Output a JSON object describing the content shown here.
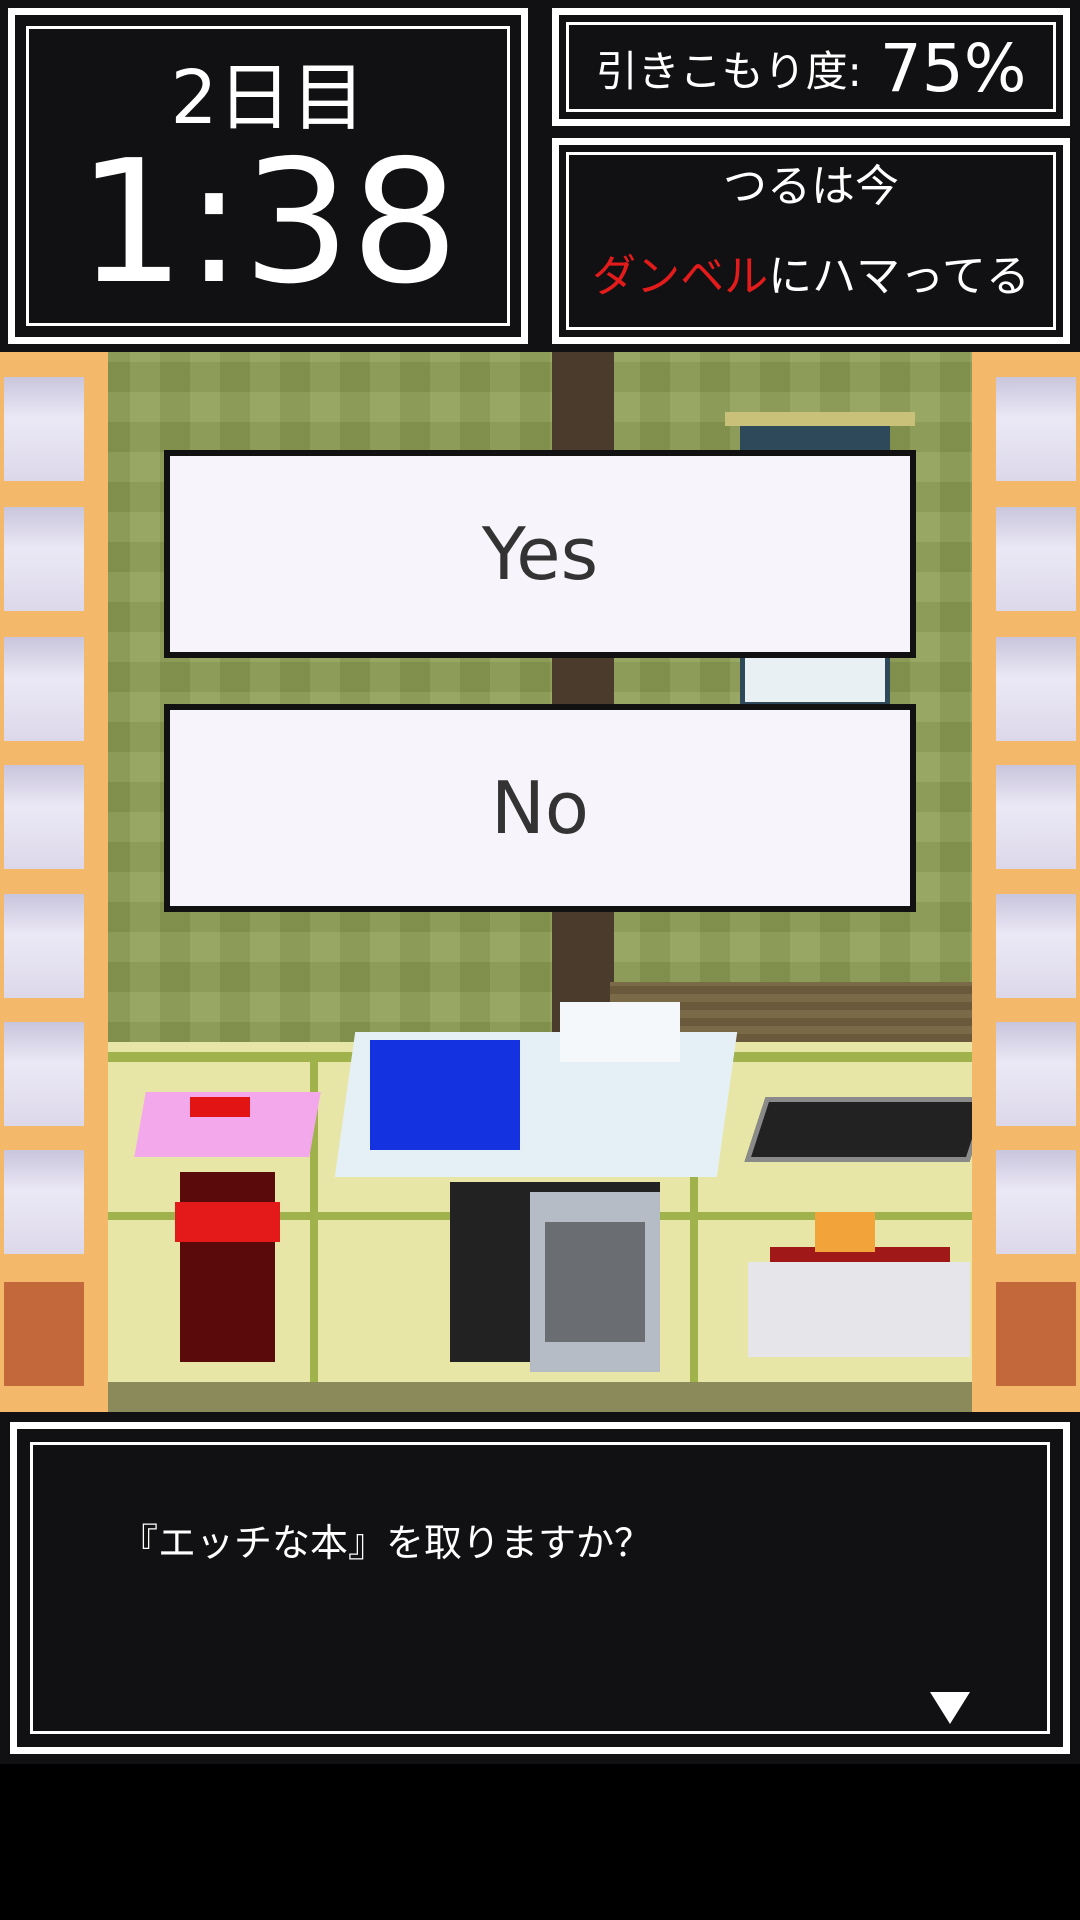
{
  "hud": {
    "day_label": "2日目",
    "clock": "1:38",
    "hikikomori_label": "引きこもり度:",
    "hikikomori_value": "75%",
    "status_line1": "つるは今",
    "status_item": "ダンベル",
    "status_suffix": "にハマってる"
  },
  "choices": {
    "yes_label": "Yes",
    "no_label": "No"
  },
  "message": {
    "text": "『エッチな本』を取りますか？",
    "next_icon": "triangle-down-icon"
  },
  "colors": {
    "panel_bg": "#111113",
    "frame": "#ffffff",
    "highlight": "#e31b1b",
    "choice_bg": "#f7f4fb"
  }
}
